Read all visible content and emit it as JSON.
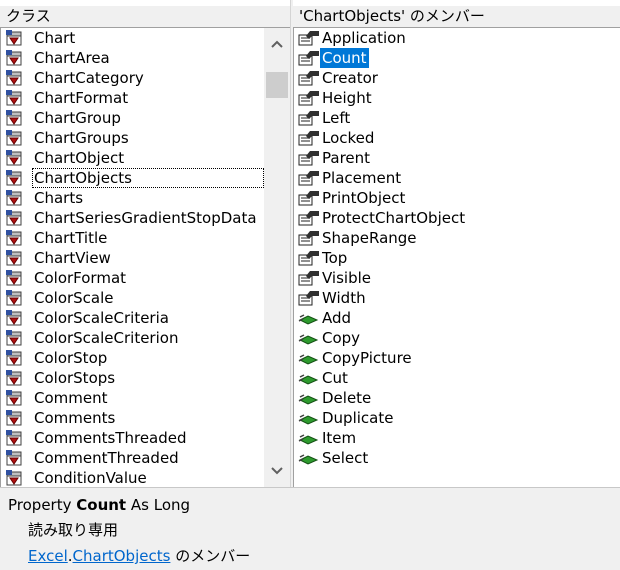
{
  "classes_panel": {
    "header": "クラス",
    "items": [
      "Chart",
      "ChartArea",
      "ChartCategory",
      "ChartFormat",
      "ChartGroup",
      "ChartGroups",
      "ChartObject",
      "ChartObjects",
      "Charts",
      "ChartSeriesGradientStopData",
      "ChartTitle",
      "ChartView",
      "ColorFormat",
      "ColorScale",
      "ColorScaleCriteria",
      "ColorScaleCriterion",
      "ColorStop",
      "ColorStops",
      "Comment",
      "Comments",
      "CommentsThreaded",
      "CommentThreaded",
      "ConditionValue"
    ],
    "focused_index": 7,
    "icon": "class-module-icon"
  },
  "members_panel": {
    "header": "'ChartObjects' のメンバー",
    "properties": [
      "Application",
      "Count",
      "Creator",
      "Height",
      "Left",
      "Locked",
      "Parent",
      "Placement",
      "PrintObject",
      "ProtectChartObject",
      "ShapeRange",
      "Top",
      "Visible",
      "Width"
    ],
    "methods": [
      "Add",
      "Copy",
      "CopyPicture",
      "Cut",
      "Delete",
      "Duplicate",
      "Item",
      "Select"
    ],
    "selected_name": "Count",
    "property_icon": "property-hand-icon",
    "method_icon": "method-green-icon"
  },
  "details": {
    "kind": "Property",
    "member": "Count",
    "type_text": "As Long",
    "access": "読み取り専用",
    "library_link": "Excel",
    "dot": ".",
    "class_link": "ChartObjects",
    "member_of": "のメンバー"
  },
  "colors": {
    "selection": "#0078d7",
    "link": "#0066cc",
    "pane_bg": "#f0f0f0"
  }
}
